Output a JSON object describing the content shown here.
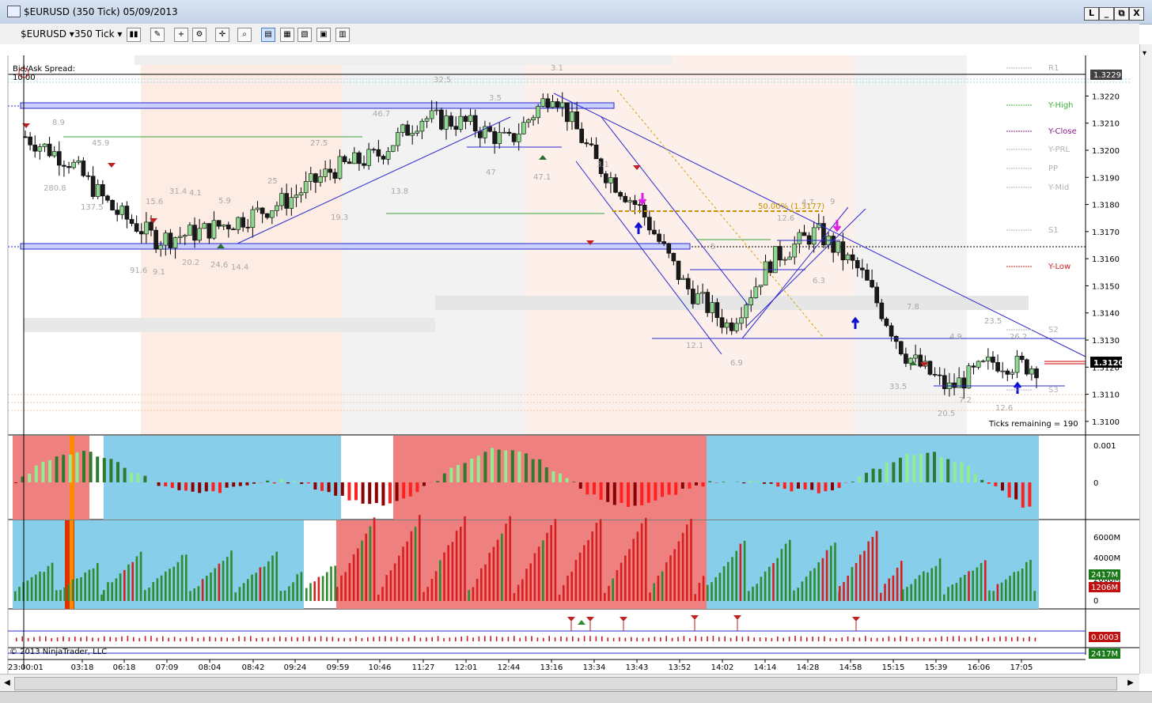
{
  "window": {
    "title": "$EURUSD (350 Tick)  05/09/2013",
    "btn_restore_left": "L",
    "btn_min": "_",
    "btn_max": "⧉",
    "btn_close": "X"
  },
  "toolbar": {
    "instrument": "$EURUSD",
    "interval": "350 Tick"
  },
  "chart": {
    "bid_ask_label": "Bid/Ask Spread:",
    "bid_ask_value": "10.00",
    "ticks_remaining": "Ticks remaining = 190",
    "fib_label": "50.00% (1.3177)",
    "copyright": "© 2013 NinjaTrader, LLC",
    "price_ticks": [
      "1.3220",
      "1.3210",
      "1.3200",
      "1.3190",
      "1.3180",
      "1.3170",
      "1.3160",
      "1.3150",
      "1.3140",
      "1.3130",
      "1.3120",
      "1.3110",
      "1.3100"
    ],
    "current_price": "1.3120",
    "top_price_box": "1.3229",
    "pivot_labels": [
      "R1",
      "Y-High",
      "Y-Close",
      "Y-PRL",
      "PP",
      "Y-Mid",
      "S1",
      "Y-Low",
      "S2",
      "S3"
    ],
    "pivot_colors": {
      "Y-High": "#3cb43c",
      "Y-Close": "#8b1a8b",
      "Y-Low": "#d02020",
      "default": "#b0b0b0"
    },
    "annotations": [
      "8.9",
      "45.9",
      "280.8",
      "137.5",
      "15.6",
      "31.4",
      "4.1",
      "5.9",
      "27.5",
      "25",
      "46.7",
      "19.3",
      "13.8",
      "20.2",
      "24.6",
      "14.4",
      "91.6",
      "9.1",
      "3.5",
      "47",
      "47.1",
      "3.1",
      "12.6",
      "4.7",
      "9",
      "5",
      "6.3",
      "7.8",
      "12.1",
      "6.9",
      "23.5",
      "26.2",
      "4.9",
      "33.5",
      "7.2",
      "20.5",
      "12.6",
      "32.5",
      "3.1"
    ]
  },
  "panels": {
    "osc_axis": [
      "0.001",
      "0"
    ],
    "vol_axis": [
      "6000M",
      "4000M",
      "2000M",
      "0"
    ],
    "vol_box_green": "2417M",
    "vol_box_red": "1206M",
    "small_box_red": "0.0003",
    "small_box_green": "2417M"
  },
  "time_axis": [
    "23:00:01",
    "03:18",
    "06:18",
    "07:09",
    "08:04",
    "08:42",
    "09:24",
    "09:59",
    "10:46",
    "11:27",
    "12:01",
    "12:44",
    "13:16",
    "13:34",
    "13:43",
    "13:52",
    "14:02",
    "14:14",
    "14:28",
    "14:58",
    "15:15",
    "15:39",
    "16:06",
    "17:05"
  ],
  "colors": {
    "bull": "#2e8b2e",
    "bear": "#d62020",
    "channel": "#2a2ad0",
    "bg_red": "#ee8080",
    "bg_blue": "#87ceeb"
  },
  "chart_data": {
    "type": "line",
    "title": "$EURUSD (350 Tick)  05/09/2013",
    "xlabel": "",
    "ylabel": "",
    "ylim": [
      1.3095,
      1.3235
    ],
    "x": [
      "23:00:01",
      "03:18",
      "06:18",
      "07:09",
      "08:04",
      "08:42",
      "09:24",
      "09:59",
      "10:46",
      "11:27",
      "12:01",
      "12:44",
      "13:16",
      "13:34",
      "13:43",
      "13:52",
      "14:02",
      "14:14",
      "14:28",
      "14:58",
      "15:15",
      "15:39",
      "16:06",
      "17:05"
    ],
    "series": [
      {
        "values": [
          1.3205,
          1.3196,
          1.3178,
          1.3167,
          1.317,
          1.3175,
          1.3182,
          1.3193,
          1.3198,
          1.3212,
          1.321,
          1.3203,
          1.3222,
          1.3195,
          1.3178,
          1.315,
          1.3135,
          1.316,
          1.317,
          1.3155,
          1.3125,
          1.3112,
          1.3122,
          1.312
        ]
      }
    ]
  }
}
